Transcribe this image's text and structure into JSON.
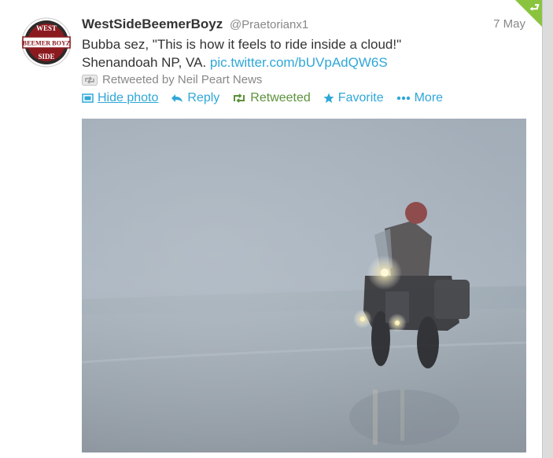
{
  "tweet": {
    "fullname": "WestSideBeemerBoyz",
    "username": "@Praetorianx1",
    "timestamp": "7 May",
    "text_line1": "Bubba sez, \"This is how it feels to ride inside a cloud!\"",
    "text_line2": "Shenandoah NP, VA. ",
    "link": "pic.twitter.com/bUVpAdQW6S",
    "retweet_context": "Retweeted by Neil Peart News",
    "avatar_text_top": "WEST",
    "avatar_text_mid": "BEEMER BOYZ",
    "avatar_text_bottom": "SIDE"
  },
  "actions": {
    "hide_photo": "Hide photo",
    "reply": "Reply",
    "retweeted": "Retweeted",
    "favorite": "Favorite",
    "more": "More"
  },
  "colors": {
    "link": "#2fa7d8",
    "retweeted_green": "#5c913b",
    "corner_green": "#8ac43f"
  }
}
